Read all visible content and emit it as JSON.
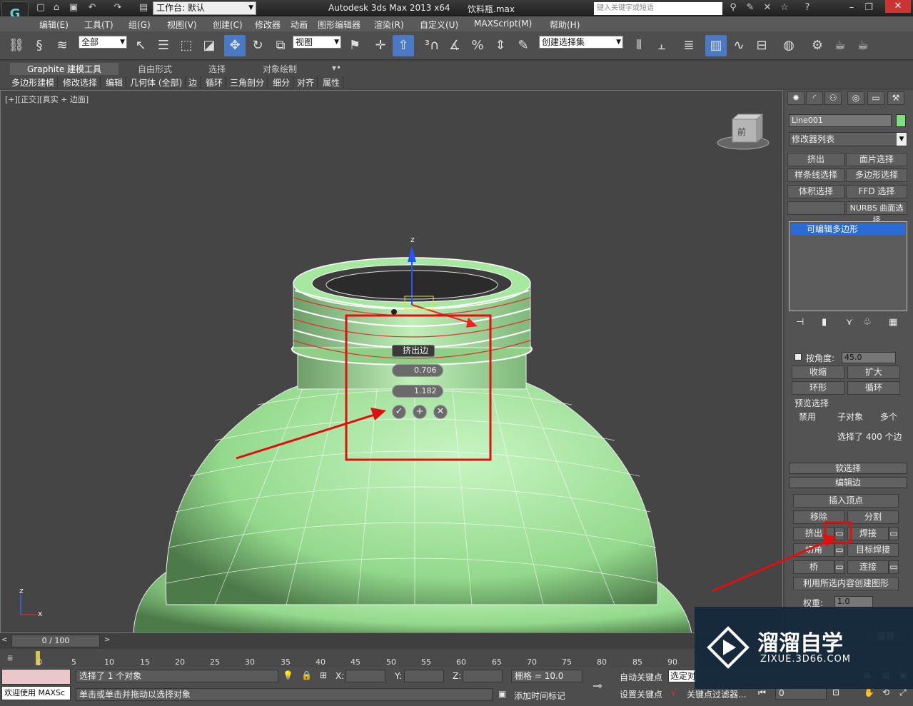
{
  "title_bar": {
    "workspace": "工作台: 默认",
    "app_title": "Autodesk 3ds Max  2013 x64",
    "file_name": "饮料瓶.max",
    "search_placeholder": "键入关键字或短语"
  },
  "menu": {
    "items": [
      "编辑(E)",
      "工具(T)",
      "组(G)",
      "视图(V)",
      "创建(C)",
      "修改器",
      "动画",
      "图形编辑器",
      "渲染(R)",
      "自定义(U)",
      "MAXScript(M)",
      "帮助(H)"
    ]
  },
  "toolbar": {
    "filter_select": "全部",
    "ref_coord": "视图",
    "named_selection": "创建选择集"
  },
  "ribbon": {
    "tabs": [
      "Graphite 建模工具",
      "自由形式",
      "选择",
      "对象绘制"
    ],
    "subtabs": [
      "多边形建模",
      "修改选择",
      "编辑",
      "几何体 (全部)",
      "边",
      "循环",
      "三角剖分",
      "细分",
      "对齐",
      "属性"
    ]
  },
  "viewport": {
    "label": "[+][正交][真实 + 边面]",
    "caddy": {
      "title": "挤出边",
      "height_value": "0.706",
      "width_value": "1.182"
    },
    "viewcube_label": "前"
  },
  "command_panel": {
    "object_name": "Line001",
    "modifier_list": "修改器列表",
    "buttons": [
      "挤出",
      "面片选择",
      "样条线选择",
      "多边形选择",
      "体积选择",
      "FFD 选择",
      "",
      "NURBS 曲面选择"
    ],
    "stack_item": "可编辑多边形",
    "by_angle_label": "按角度:",
    "by_angle_value": "45.0",
    "shrink": "收缩",
    "grow": "扩大",
    "ring": "环形",
    "loop": "循环",
    "preview_label": "预览选择",
    "preview_disabled": "禁用",
    "preview_subobject": "子对象",
    "preview_multi": "多个",
    "selection_info": "选择了 400 个边",
    "soft_selection": "软选择",
    "edit_edges": "编辑边",
    "insert_vertex": "插入顶点",
    "remove": "移除",
    "split": "分割",
    "extrude": "挤出",
    "weld": "焊接",
    "chamfer": "切角",
    "target_weld": "目标焊接",
    "bridge": "桥",
    "connect": "连接",
    "create_shape": "利用所选内容创建图形",
    "weight_label": "权重:",
    "weight_value": "1.0",
    "rotate": "旋转"
  },
  "timeline": {
    "frame_display": "0 / 100",
    "ticks": [
      "0",
      "5",
      "10",
      "15",
      "20",
      "25",
      "30",
      "35",
      "40",
      "45",
      "50",
      "55",
      "60",
      "65",
      "70",
      "75",
      "80",
      "85",
      "90"
    ]
  },
  "status_bar": {
    "welcome": "欢迎使用 MAXSc",
    "selected": "选择了 1 个对象",
    "hint": "单击或单击并拖动以选择对象",
    "x_label": "X:",
    "y_label": "Y:",
    "z_label": "Z:",
    "grid": "栅格 = 10.0",
    "add_time_tag": "添加时间标记",
    "auto_key": "自动关键点",
    "selected_obj": "选定对",
    "set_key": "设置关键点",
    "key_filters": "关键点过滤器...",
    "frame_value": "0"
  },
  "watermark": {
    "brand": "溜溜自学",
    "url": "ZIXUE.3D66.COM"
  },
  "colors": {
    "annotation_red": "#e01010",
    "mesh_green": "#a6e8a0",
    "panel_gray": "#535353"
  }
}
